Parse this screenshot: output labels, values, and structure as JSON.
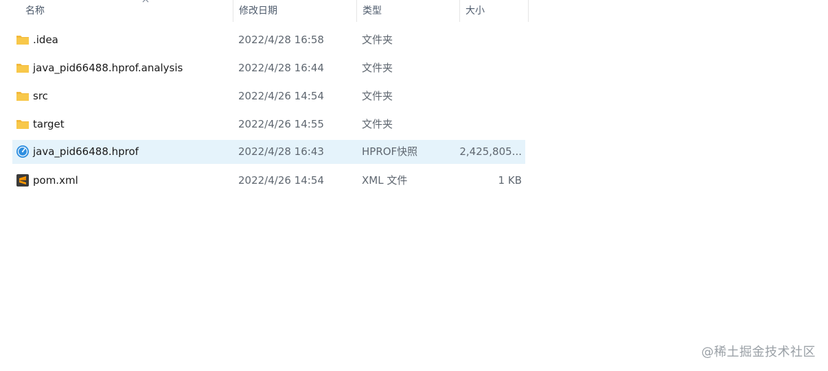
{
  "columns": {
    "name": "名称",
    "date": "修改日期",
    "type": "类型",
    "size": "大小"
  },
  "rows": [
    {
      "icon": "folder-icon",
      "name": ".idea",
      "date": "2022/4/28 16:58",
      "type": "文件夹",
      "size": ""
    },
    {
      "icon": "folder-icon",
      "name": "java_pid66488.hprof.analysis",
      "date": "2022/4/28 16:44",
      "type": "文件夹",
      "size": ""
    },
    {
      "icon": "folder-icon",
      "name": "src",
      "date": "2022/4/26 14:54",
      "type": "文件夹",
      "size": ""
    },
    {
      "icon": "folder-icon",
      "name": "target",
      "date": "2022/4/26 14:55",
      "type": "文件夹",
      "size": ""
    },
    {
      "icon": "hprof-file-icon",
      "name": "java_pid66488.hprof",
      "date": "2022/4/28 16:43",
      "type": "HPROF快照",
      "size": "2,425,805...",
      "selected": true
    },
    {
      "icon": "sublime-text-file-icon",
      "name": "pom.xml",
      "date": "2022/4/26 14:54",
      "type": "XML 文件",
      "size": "1 KB"
    }
  ],
  "watermark": "@稀土掘金技术社区",
  "colors": {
    "selected_row": "#e5f3fb",
    "folder": "#f8c84a",
    "text_secondary": "#5f6770"
  }
}
